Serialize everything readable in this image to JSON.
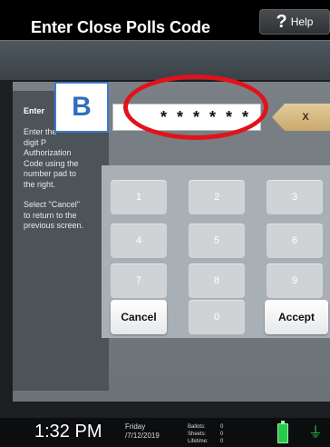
{
  "header": {
    "help_label": "Help",
    "help_glyph": "?"
  },
  "screen": {
    "title": "Enter Close Polls Code"
  },
  "instructions": {
    "heading": "Enter",
    "line1": "Enter the",
    "line2": "digit P",
    "line3": "Authorization",
    "line4": "Code using the",
    "line5": "number pad to",
    "line6": "the right.",
    "cancel_line1": "Select \"Cancel\"",
    "cancel_line2": "to return to the",
    "cancel_line3": "previous screen."
  },
  "code_entry": {
    "masked_value": "* * * * * *",
    "clear_label": "X"
  },
  "keypad": {
    "keys": [
      "1",
      "2",
      "3",
      "4",
      "5",
      "6",
      "7",
      "8",
      "9"
    ],
    "cancel_label": "Cancel",
    "zero_label": "0",
    "accept_label": "Accept"
  },
  "annotation": {
    "marker_label": "B",
    "highlight_color": "#e2121b",
    "marker_color": "#2f6fbd"
  },
  "status": {
    "time": "1:32 PM",
    "day": "Friday",
    "date": "/7/12/2019",
    "ballots_label": "Ballots:",
    "ballots_value": "0",
    "sheets_label": "Sheets:",
    "sheets_value": "0",
    "lifetime_label": "Lifetime:",
    "lifetime_value": "0",
    "battery_color": "#2bc94a"
  }
}
